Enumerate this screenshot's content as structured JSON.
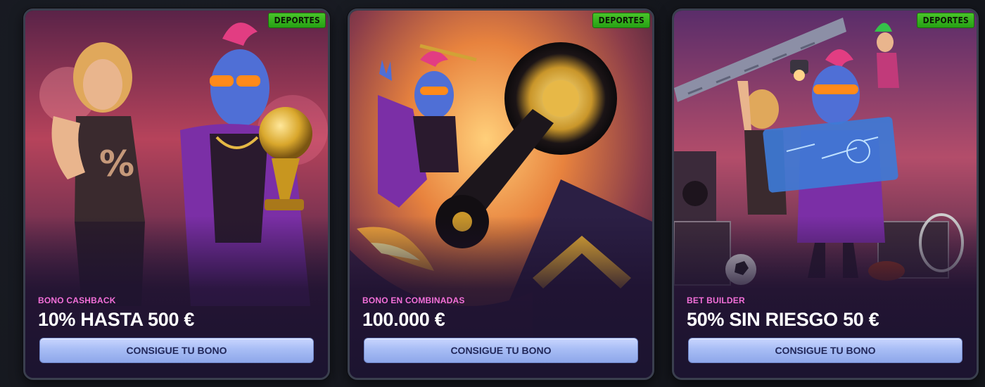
{
  "cards": [
    {
      "badge": "DEPORTES",
      "label": "BONO CASHBACK",
      "title": "10% HASTA 500 €",
      "cta": "CONSIGUE TU BONO"
    },
    {
      "badge": "DEPORTES",
      "label": "BONO EN COMBINADAS",
      "title": "100.000 €",
      "cta": "CONSIGUE TU BONO"
    },
    {
      "badge": "DEPORTES",
      "label": "BET BUILDER",
      "title": "50% SIN RIESGO 50 €",
      "cta": "CONSIGUE TU BONO"
    }
  ],
  "colors": {
    "badge": "#3fb821",
    "label": "#f26fd8",
    "cta_bg": "#a8bdf5",
    "cta_text": "#22285a"
  }
}
